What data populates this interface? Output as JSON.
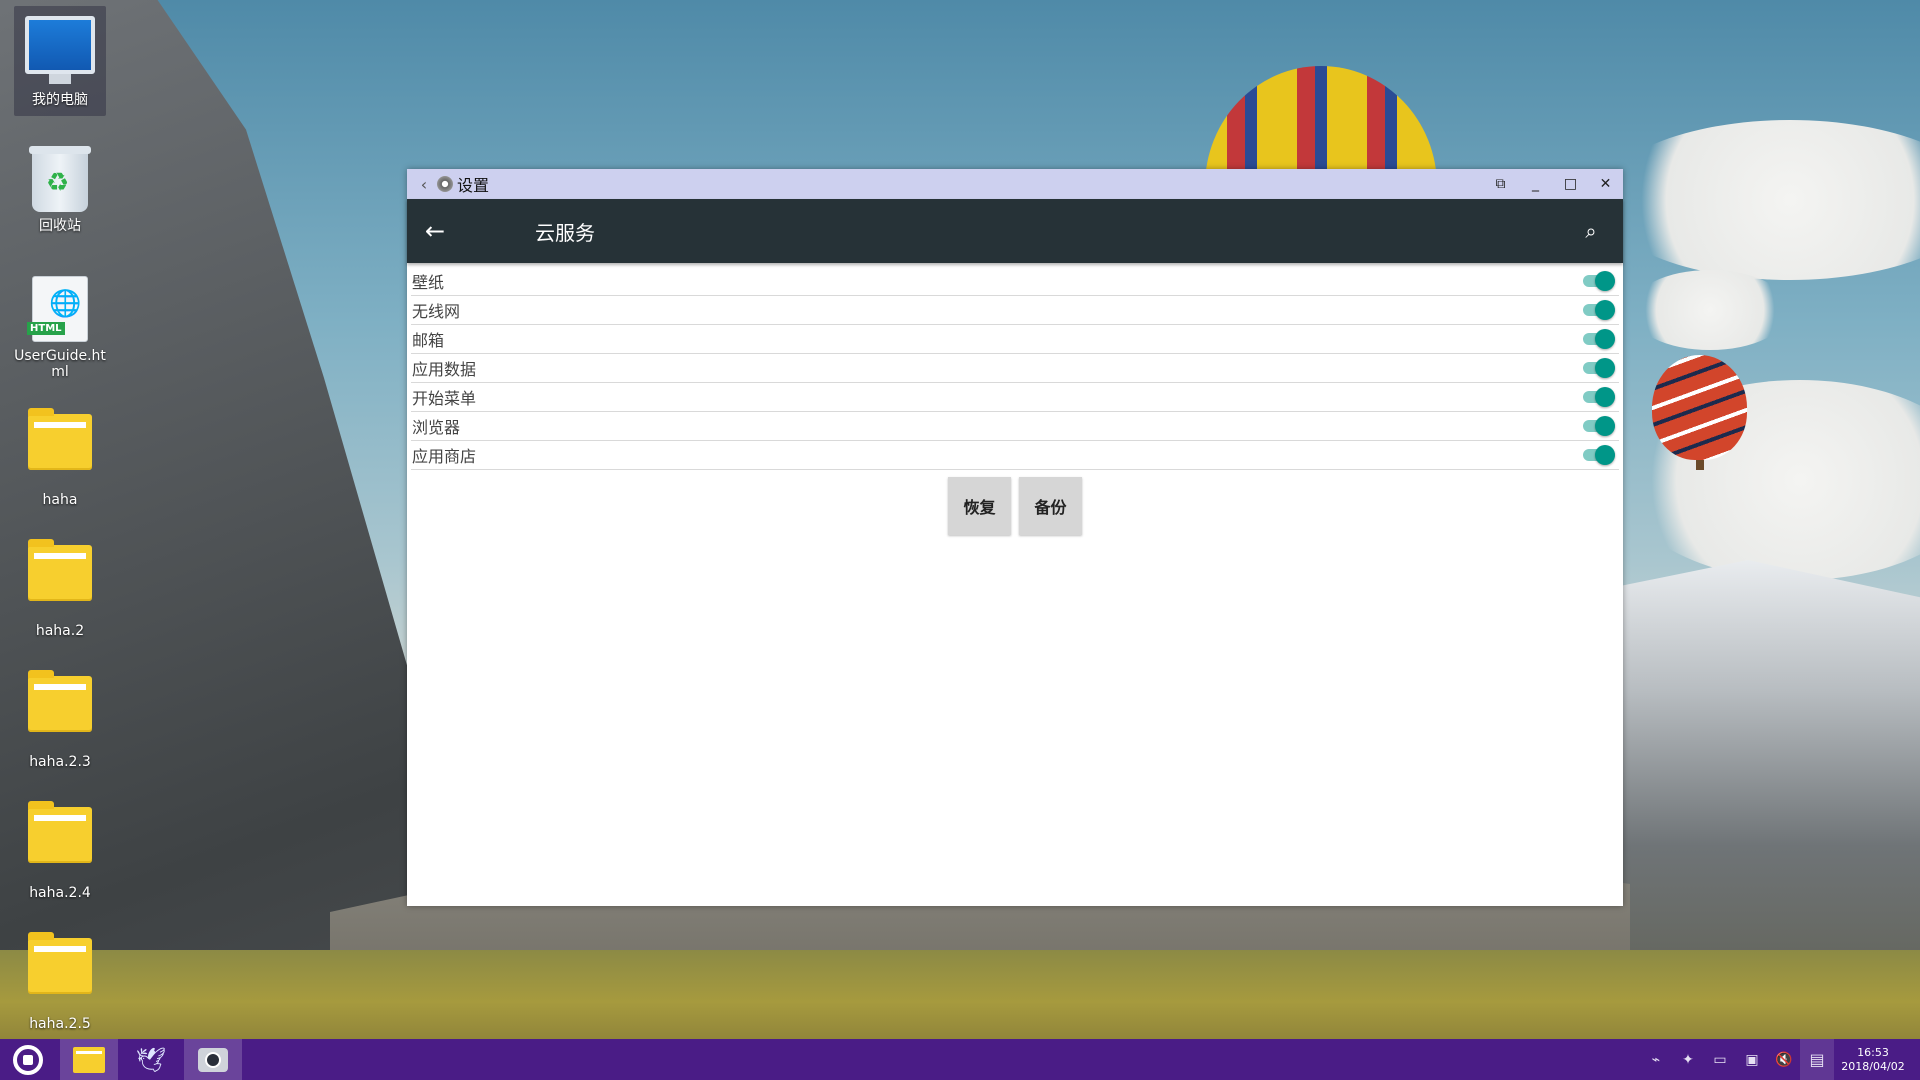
{
  "desktop": {
    "icons": [
      {
        "label": "我的电脑",
        "icon": "computer-icon"
      },
      {
        "label": "回收站",
        "icon": "recycle-bin-icon"
      },
      {
        "label": "UserGuide.html",
        "icon": "html-file-icon"
      },
      {
        "label": "haha",
        "icon": "folder-icon"
      },
      {
        "label": "haha.2",
        "icon": "folder-icon"
      },
      {
        "label": "haha.2.3",
        "icon": "folder-icon"
      },
      {
        "label": "haha.2.4",
        "icon": "folder-icon"
      },
      {
        "label": "haha.2.5",
        "icon": "folder-icon"
      }
    ]
  },
  "window": {
    "title": "设置",
    "back_glyph": "‹",
    "controls": {
      "pin": "⧉",
      "minimize": "_",
      "maximize": "□",
      "close": "✕"
    }
  },
  "appbar": {
    "title": "云服务",
    "back_glyph": "←",
    "search_glyph": "⌕"
  },
  "sync_items": [
    {
      "label": "壁纸",
      "enabled": true
    },
    {
      "label": "无线网",
      "enabled": true
    },
    {
      "label": "邮箱",
      "enabled": true
    },
    {
      "label": "应用数据",
      "enabled": true
    },
    {
      "label": "开始菜单",
      "enabled": true
    },
    {
      "label": "浏览器",
      "enabled": true
    },
    {
      "label": "应用商店",
      "enabled": true
    }
  ],
  "buttons": {
    "restore": "恢复",
    "backup": "备份"
  },
  "colors": {
    "titlebar": "#cdd0ef",
    "appbar": "#263237",
    "toggle_on": "#009688",
    "taskbar": "#4a1c86"
  },
  "taskbar": {
    "clock_time": "16:53",
    "clock_date": "2018/04/02"
  }
}
